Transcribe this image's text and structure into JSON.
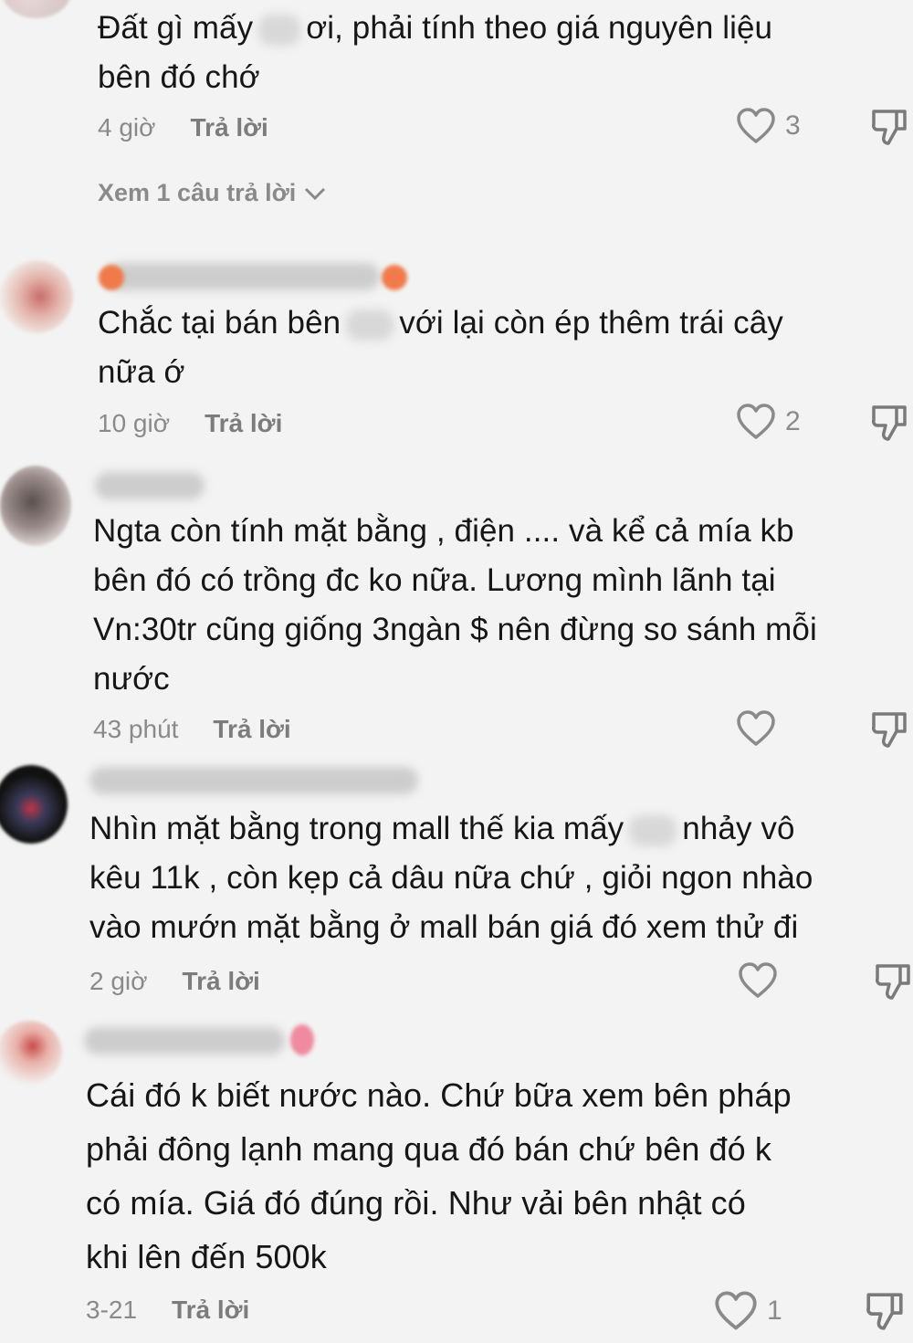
{
  "comments": [
    {
      "text_before": "Đất gì mấy",
      "text_after": "ơi, phải tính theo giá nguyên liệu",
      "text_line2": "bên đó chớ",
      "time": "4 giờ",
      "reply_label": "Trả lời",
      "likes": "3",
      "view_replies": "Xem 1 câu trả lời"
    },
    {
      "text_before": "Chắc tại bán bên",
      "text_after": "với lại còn ép thêm trái cây",
      "text_line2": "nữa ớ",
      "time": "10 giờ",
      "reply_label": "Trả lời",
      "likes": "2"
    },
    {
      "line1": "Ngta còn tính mặt bằng , điện .... và kể cả mía kb",
      "line2": "bên đó có trồng đc ko nữa. Lương mình lãnh tại",
      "line3": "Vn:30tr cũng giống 3ngàn $ nên đừng so sánh mỗi",
      "line4": "nước",
      "time": "43 phút",
      "reply_label": "Trả lời"
    },
    {
      "text_before": "Nhìn mặt bằng trong mall thế kia mấy",
      "text_after": "nhảy vô",
      "line2": "kêu 11k , còn kẹp cả dâu nữa chứ , giỏi ngon nhào",
      "line3": "vào mướn mặt bằng ở mall bán giá đó xem thử đi",
      "time": "2 giờ",
      "reply_label": "Trả lời"
    },
    {
      "line1": "Cái đó k biết nước nào. Chứ bữa xem bên pháp",
      "line2": "phải đông lạnh mang qua đó bán chứ bên đó k",
      "line3": "có mía. Giá đó đúng rồi. Như vải bên nhật có",
      "line4": "khi lên đến 500k",
      "time": "3-21",
      "reply_label": "Trả lời",
      "likes": "1"
    }
  ],
  "colors": {
    "background": "#f3f3f3",
    "text": "#161616",
    "meta": "#8a8a8a"
  },
  "icons": {
    "like": "heart-outline-icon",
    "dislike": "thumbs-down-outline-icon",
    "expand": "chevron-down-icon"
  }
}
